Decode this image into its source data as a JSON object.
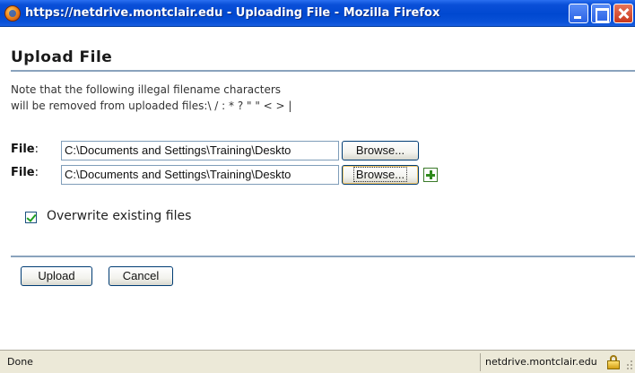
{
  "window": {
    "title": "https://netdrive.montclair.edu - Uploading File - Mozilla Firefox"
  },
  "page": {
    "heading": "Upload File",
    "note_line1": "Note that the following illegal filename characters",
    "note_line2": "will be removed from uploaded files:\\ / : * ? \" \" < > |"
  },
  "files": [
    {
      "label": "File",
      "value": "C:\\Documents and Settings\\Training\\Deskto",
      "browse_label": "Browse..."
    },
    {
      "label": "File",
      "value": "C:\\Documents and Settings\\Training\\Deskto",
      "browse_label": "Browse..."
    }
  ],
  "overwrite": {
    "label": "Overwrite existing files",
    "checked": true
  },
  "actions": {
    "upload_label": "Upload",
    "cancel_label": "Cancel"
  },
  "statusbar": {
    "status": "Done",
    "host": "netdrive.montclair.edu"
  },
  "icons": {
    "app": "firefox-icon",
    "add": "add-file-icon",
    "lock": "lock-icon"
  }
}
